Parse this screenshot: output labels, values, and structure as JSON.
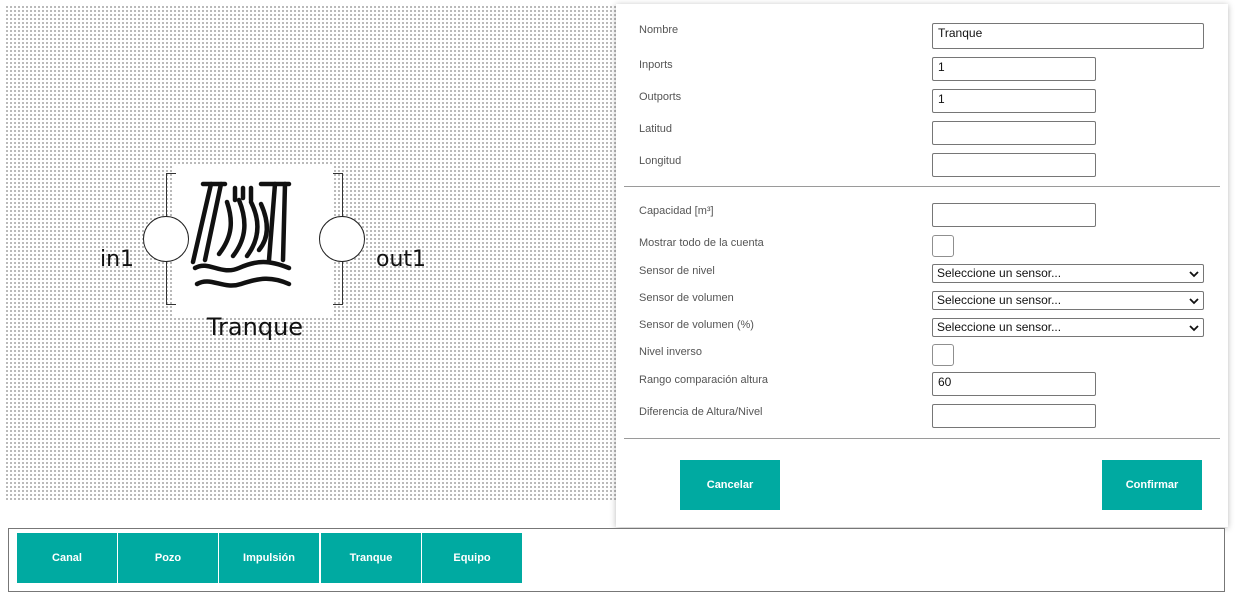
{
  "canvas": {
    "block": {
      "name": "Tranque",
      "in_port": "in1",
      "out_port": "out1",
      "icon": "dam-waterfall-icon"
    }
  },
  "form": {
    "nombre": {
      "label": "Nombre",
      "value": "Tranque"
    },
    "inports": {
      "label": "Inports",
      "value": "1"
    },
    "outports": {
      "label": "Outports",
      "value": "1"
    },
    "latitud": {
      "label": "Latitud",
      "value": ""
    },
    "longitud": {
      "label": "Longitud",
      "value": ""
    },
    "capacidad": {
      "label": "Capacidad [m³]",
      "value": ""
    },
    "mostrar_todo": {
      "label": "Mostrar todo de la cuenta",
      "checked": false
    },
    "sensor_nivel": {
      "label": "Sensor de nivel",
      "value": "Seleccione un sensor..."
    },
    "sensor_volumen": {
      "label": "Sensor de volumen",
      "value": "Seleccione un sensor..."
    },
    "sensor_volumen_pct": {
      "label": "Sensor de volumen (%)",
      "value": "Seleccione un sensor..."
    },
    "nivel_inverso": {
      "label": "Nivel inverso",
      "checked": false
    },
    "rango_comparacion": {
      "label": "Rango comparación altura",
      "value": "60"
    },
    "diferencia_altura": {
      "label": "Diferencia de Altura/Nivel",
      "value": ""
    },
    "cancel_label": "Cancelar",
    "confirm_label": "Confirmar"
  },
  "toolbar": {
    "buttons": [
      "Canal",
      "Pozo",
      "Impulsión",
      "Tranque",
      "Equipo"
    ]
  },
  "colors": {
    "accent": "#00aaa1",
    "canvas_dots": "#a9a9a9"
  }
}
